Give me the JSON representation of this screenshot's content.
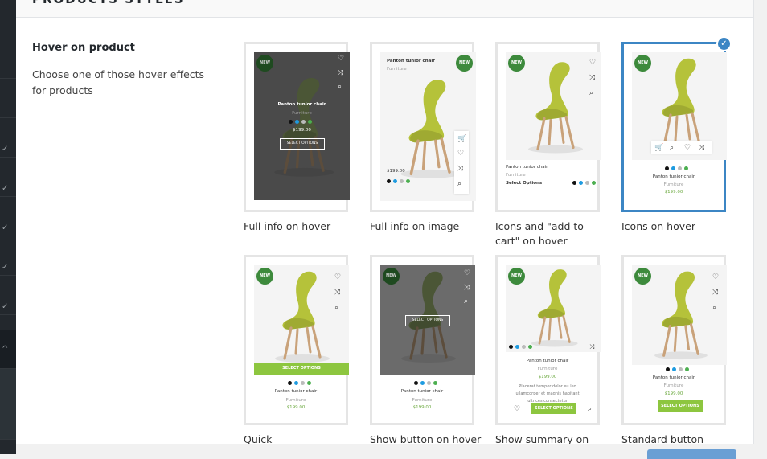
{
  "panel": {
    "title": "PRODUCTS STYLES"
  },
  "setting": {
    "title": "Hover on product",
    "description": "Choose one of those hover effects for products"
  },
  "product": {
    "name": "Panton tunior chair",
    "category": "Furniture",
    "price": "$199.00",
    "badge": "NEW",
    "select_options": "SELECT OPTIONS",
    "select_options_alt": "Select Options",
    "summary": "Placerat tempor dolor eu leo ullamcorper et magnis habitant ultrices consectetur"
  },
  "options": [
    {
      "label": "Full info on hover",
      "selected": false
    },
    {
      "label": "Full info on image",
      "selected": false
    },
    {
      "label": "Icons and \"add to cart\" on hover",
      "selected": false
    },
    {
      "label": "Icons on hover",
      "selected": true
    },
    {
      "label": "Quick",
      "selected": false
    },
    {
      "label": "Show button on hover",
      "selected": false
    },
    {
      "label": "Show summary on hover",
      "selected": false
    },
    {
      "label": "Standard button",
      "selected": false
    }
  ],
  "colors": {
    "accent": "#3c86c4",
    "badge": "#3d8a3c",
    "price": "#6aa83d",
    "button": "#8dc63f",
    "chair": "#b5c23a"
  },
  "swatches": [
    "#111111",
    "#1e9be0",
    "#bbbbbb",
    "#4caf50"
  ],
  "icons": [
    "heart-icon",
    "shuffle-icon",
    "search-icon",
    "cart-icon",
    "check-icon"
  ]
}
